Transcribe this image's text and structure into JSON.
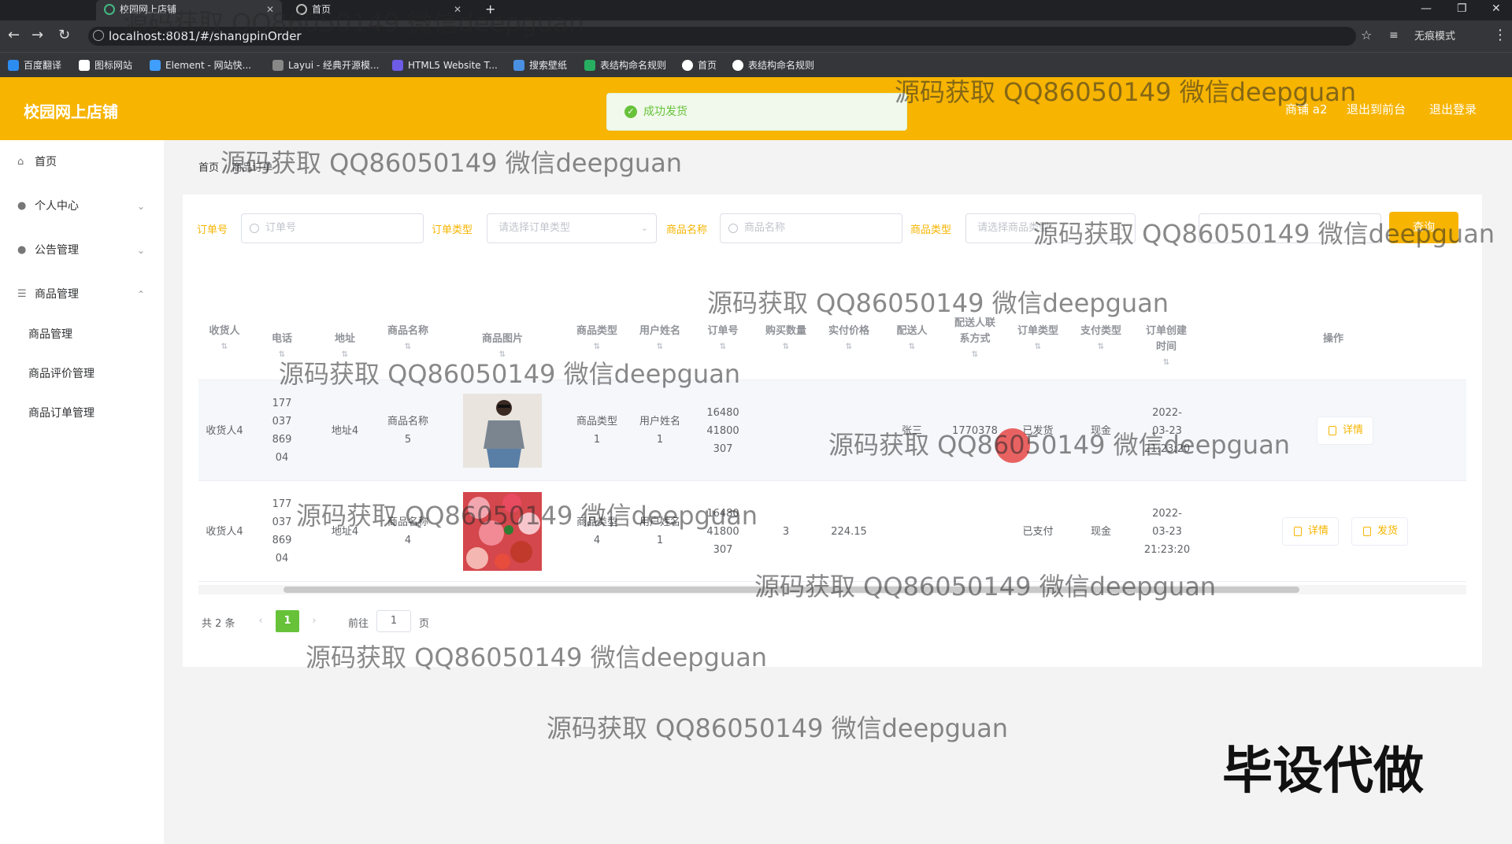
{
  "browser": {
    "tabs": [
      {
        "title": "校园网上店铺",
        "active": true
      },
      {
        "title": "首页",
        "active": false
      }
    ],
    "new_tab": "+",
    "url": "localhost:8081/#/shangpinOrder",
    "bookmarks": [
      "百度翻译",
      "图标网站",
      "Element - 网站快...",
      "Layui - 经典开源模...",
      "HTML5 Website T...",
      "搜索壁纸",
      "表结构命名规则",
      "首页",
      "表结构命名规则"
    ],
    "profile_label": "无痕模式"
  },
  "header": {
    "brand": "校园网上店铺",
    "store_label": "商铺 a2",
    "back_front": "退出到前台",
    "logout": "退出登录"
  },
  "toast": {
    "text": "成功发货",
    "color": "#67c23a"
  },
  "sidebar": {
    "items": [
      {
        "label": "首页",
        "icon": "home-icon"
      },
      {
        "label": "个人中心",
        "icon": "user-icon"
      },
      {
        "label": "公告管理",
        "icon": "user-icon"
      },
      {
        "label": "商品管理",
        "icon": "list-icon"
      }
    ],
    "submenu": [
      "商品管理",
      "商品评价管理",
      "商品订单管理"
    ]
  },
  "breadcrumb": {
    "home": "首页",
    "current": "商品订单"
  },
  "search": {
    "order_no_label": "订单号",
    "order_no_placeholder": "订单号",
    "order_type_label": "订单类型",
    "order_type_placeholder": "请选择订单类型",
    "goods_name_label": "商品名称",
    "goods_name_placeholder": "商品名称",
    "goods_type_label": "商品类型",
    "goods_type_placeholder": "请选择商品类型",
    "search_button": "查询"
  },
  "table": {
    "headers": [
      "收货人",
      "电话",
      "地址",
      "商品名称",
      "商品图片",
      "商品类型",
      "用户姓名",
      "订单号",
      "购买数量",
      "实付价格",
      "配送人",
      "配送人联系方式",
      "订单类型",
      "支付类型",
      "订单创建时间",
      "操作"
    ],
    "rows": [
      {
        "receiver": "收货人4",
        "phone": "17703786904",
        "address": "地址4",
        "goods_name": "商品名称5",
        "goods_type": "商品类型1",
        "user_name": "用户姓名1",
        "order_no": "1648041800307",
        "qty": "",
        "price": "",
        "courier": "张三",
        "courier_phone": "1770378",
        "order_type": "已发货",
        "pay_type": "现金",
        "created": "2022-03-23 21:23:20",
        "actions": [
          "详情"
        ]
      },
      {
        "receiver": "收货人4",
        "phone": "17703786904",
        "address": "地址4",
        "goods_name": "商品名称4",
        "goods_type": "商品类型4",
        "user_name": "用户姓名1",
        "order_no": "1648041800307",
        "qty": "3",
        "price": "224.15",
        "courier": "",
        "courier_phone": "",
        "order_type": "已支付",
        "pay_type": "现金",
        "created": "2022-03-23 21:23:20",
        "actions": [
          "详情",
          "发货"
        ]
      }
    ]
  },
  "pagination": {
    "total": "共 2 条",
    "current": "1",
    "goto": "前往",
    "goto_value": "1",
    "unit": "页"
  },
  "watermark": "源码获取 QQ86050149 微信deepguan",
  "stamp": "毕设代做",
  "colors": {
    "accent": "#f7b400",
    "success": "#67c23a"
  }
}
